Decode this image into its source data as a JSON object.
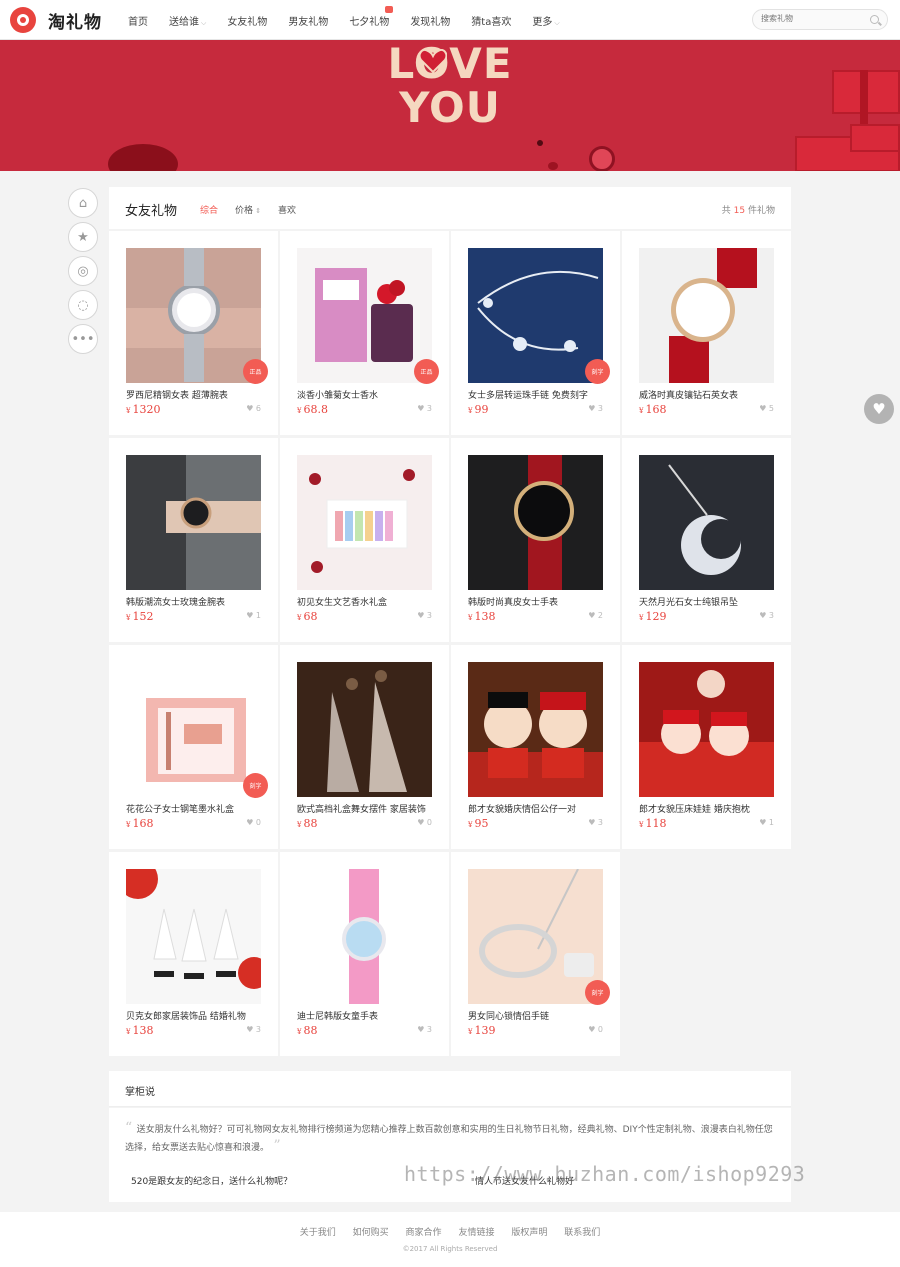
{
  "header": {
    "logo_text": "淘礼物",
    "nav": [
      {
        "label": "首页",
        "caret": ""
      },
      {
        "label": "送给谁",
        "caret": "⌵"
      },
      {
        "label": "女友礼物",
        "caret": ""
      },
      {
        "label": "男友礼物",
        "caret": ""
      },
      {
        "label": "七夕礼物",
        "caret": ""
      },
      {
        "label": "发现礼物",
        "caret": ""
      },
      {
        "label": "猜ta喜欢",
        "caret": ""
      },
      {
        "label": "更多",
        "caret": "⌵"
      }
    ],
    "search_placeholder": "搜索礼物"
  },
  "banner": {
    "line1": "LOVE",
    "line2": "YOU",
    "accent": "#c62a3d"
  },
  "social_icons": [
    "qq-icon",
    "star-icon",
    "weibo-icon",
    "wechat-icon",
    "more-icon"
  ],
  "list": {
    "title": "女友礼物",
    "sort_comprehensive": "综合",
    "sort_price": "价格",
    "sort_like": "喜欢",
    "count_prefix": "共",
    "count_value": "15",
    "count_suffix": "件礼物"
  },
  "products": [
    {
      "name": "罗西尼精钢女表 超薄腕表",
      "price": "1320",
      "likes": "6",
      "tag": "正品"
    },
    {
      "name": "淡香小雏菊女士香水",
      "price": "68.8",
      "likes": "3",
      "tag": "正品"
    },
    {
      "name": "女士多层转运珠手链 免费刻字",
      "price": "99",
      "likes": "3",
      "tag": "刻字"
    },
    {
      "name": "威洛时真皮镶钻石英女表",
      "price": "168",
      "likes": "5",
      "tag": ""
    },
    {
      "name": "韩版潮流女士玫瑰金腕表",
      "price": "152",
      "likes": "1",
      "tag": ""
    },
    {
      "name": "初见女生文艺香水礼盒",
      "price": "68",
      "likes": "3",
      "tag": ""
    },
    {
      "name": "韩版时尚真皮女士手表",
      "price": "138",
      "likes": "2",
      "tag": ""
    },
    {
      "name": "天然月光石女士纯银吊坠",
      "price": "129",
      "likes": "3",
      "tag": ""
    },
    {
      "name": "花花公子女士钢笔墨水礼盒",
      "price": "168",
      "likes": "0",
      "tag": "刻字"
    },
    {
      "name": "欧式高档礼盒舞女摆件 家居装饰",
      "price": "88",
      "likes": "0",
      "tag": ""
    },
    {
      "name": "郎才女貌婚庆情侣公仔一对",
      "price": "95",
      "likes": "3",
      "tag": ""
    },
    {
      "name": "郎才女貌压床娃娃 婚庆抱枕",
      "price": "118",
      "likes": "1",
      "tag": ""
    },
    {
      "name": "贝克女郎家居装饰品 结婚礼物",
      "price": "138",
      "likes": "3",
      "tag": ""
    },
    {
      "name": "迪士尼韩版女童手表",
      "price": "88",
      "likes": "3",
      "tag": ""
    },
    {
      "name": "男女同心锁情侣手链",
      "price": "139",
      "likes": "0",
      "tag": "刻字"
    }
  ],
  "talk": {
    "title": "掌柜说",
    "quote": "送女朋友什么礼物好？可可礼物网女友礼物排行榜频道为您精心推荐上数百款创意和实用的生日礼物节日礼物，经典礼物、DIY个性定制礼物、浪漫表白礼物任您选择，给女票送去贴心惊喜和浪漫。",
    "q1": "520是跟女友的纪念日，送什么礼物呢？",
    "q2": "情人节送女友什么礼物好"
  },
  "watermark": "https://www.huzhan.com/ishop9293",
  "footer": {
    "links": [
      "关于我们",
      "如何购买",
      "商家合作",
      "友情链接",
      "版权声明",
      "联系我们"
    ],
    "copyright": "©2017 All Rights Reserved"
  },
  "currency": "¥",
  "heart": "♥"
}
